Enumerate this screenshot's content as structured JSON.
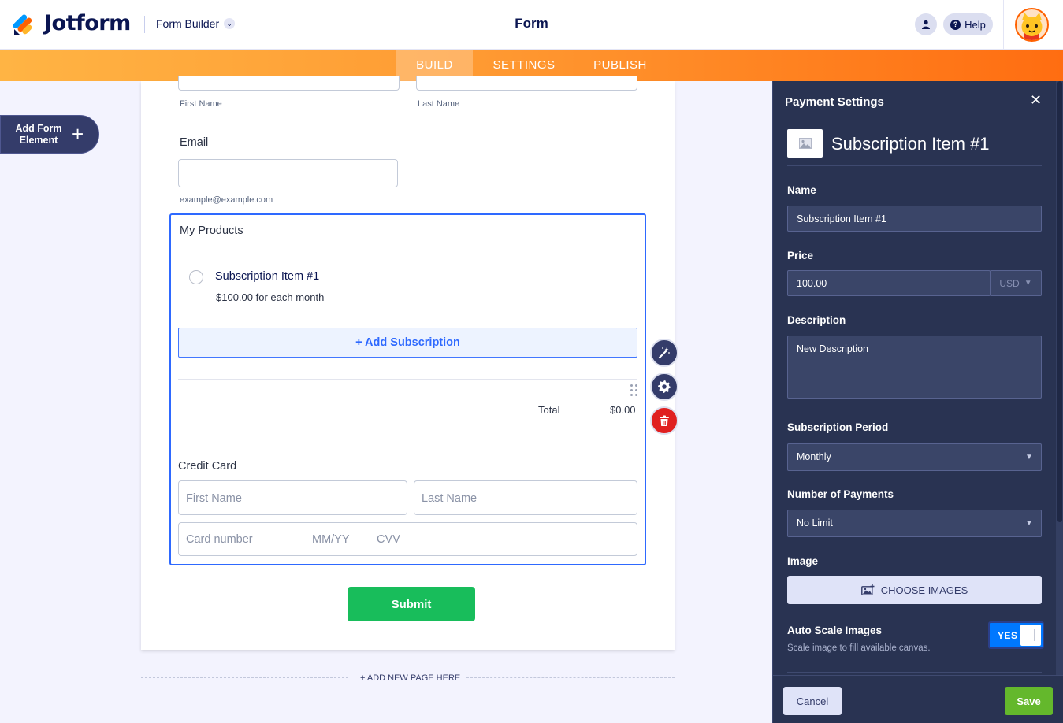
{
  "header": {
    "brand": "Jotform",
    "mode_label": "Form Builder",
    "form_title": "Form",
    "help_label": "Help"
  },
  "nav": {
    "tabs": [
      {
        "label": "BUILD",
        "active": true
      },
      {
        "label": "SETTINGS",
        "active": false
      },
      {
        "label": "PUBLISH",
        "active": false
      }
    ]
  },
  "sidebar": {
    "add_element_label": "Add Form Element"
  },
  "form": {
    "name_sublabels": {
      "first": "First Name",
      "last": "Last Name"
    },
    "email": {
      "label": "Email",
      "sublabel": "example@example.com"
    },
    "products": {
      "label": "My Products",
      "item_name": "Subscription Item #1",
      "item_price": "$100.00 for each month",
      "add_button": "+ Add Subscription",
      "total_label": "Total",
      "total_value": "$0.00"
    },
    "credit_card": {
      "label": "Credit Card",
      "first_name_placeholder": "First Name",
      "last_name_placeholder": "Last Name",
      "card_number_placeholder": "Card number",
      "expiry_placeholder": "MM/YY",
      "cvv_placeholder": "CVV"
    },
    "submit_label": "Submit",
    "add_page_label": "+ ADD NEW PAGE HERE"
  },
  "panel": {
    "title": "Payment Settings",
    "item_heading": "Subscription Item #1",
    "name_label": "Name",
    "name_value": "Subscription Item #1",
    "price_label": "Price",
    "price_value": "100.00",
    "currency": "USD",
    "description_label": "Description",
    "description_value": "New Description",
    "period_label": "Subscription Period",
    "period_value": "Monthly",
    "payments_label": "Number of Payments",
    "payments_value": "No Limit",
    "image_label": "Image",
    "choose_images": "CHOOSE IMAGES",
    "auto_scale_label": "Auto Scale Images",
    "auto_scale_help": "Scale image to fill available canvas.",
    "auto_scale_state": "YES",
    "cancel_label": "Cancel",
    "save_label": "Save"
  },
  "colors": {
    "accent_orange": "#ff6100",
    "brand_navy": "#0a1551",
    "panel_bg": "#293352",
    "selection_blue": "#2e69ff",
    "submit_green": "#18bd5b",
    "save_green": "#64b82c",
    "delete_red": "#e02020"
  },
  "icons": [
    "jotform-logo",
    "chevron-down-icon",
    "user-icon",
    "help-icon",
    "avatar",
    "plus-icon",
    "magic-wand-icon",
    "gear-icon",
    "trash-icon",
    "drag-handle-icon",
    "close-icon",
    "image-icon",
    "select-arrow-icon"
  ]
}
